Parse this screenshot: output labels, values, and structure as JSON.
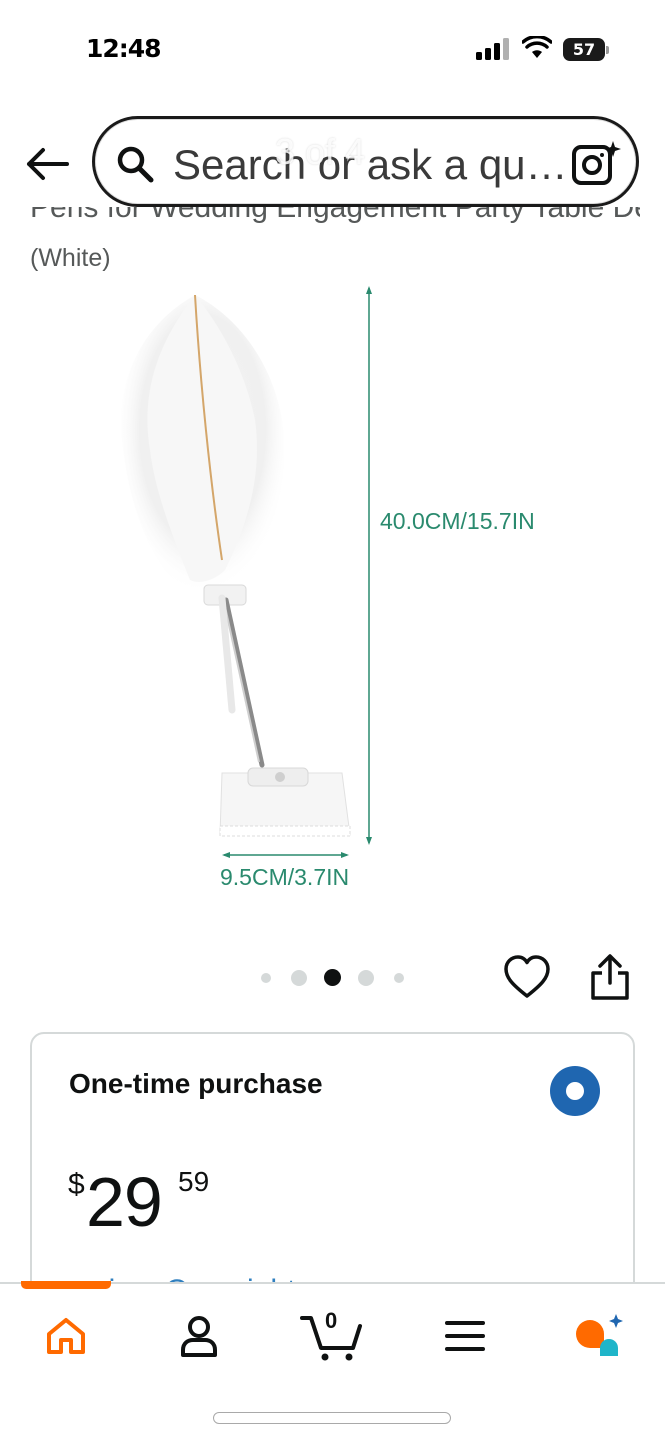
{
  "status_bar": {
    "time": "12:48",
    "battery": "57"
  },
  "header": {
    "search_placeholder": "Search or ask a qu…",
    "page_indicator": "3 of 4"
  },
  "product": {
    "title_line1": "Pens for Wedding Engagement Party Table Decor",
    "title_line2": "(White)",
    "image": {
      "height_label": "40.0CM/15.7IN",
      "width_label": "9.5CM/3.7IN"
    },
    "carousel": {
      "dot_count": 5,
      "active_index": 2
    }
  },
  "purchase": {
    "option_title": "One-time purchase",
    "price_symbol": "$",
    "price_whole": "29",
    "price_fraction": "59",
    "delivery_partial": "prime Overnight"
  },
  "bottom_nav": {
    "cart_count": "0",
    "active_tab": "home"
  },
  "colors": {
    "accent_orange": "#ff6a00",
    "radio_blue": "#1f66b0",
    "dimension_green": "#2a8a6e",
    "ai_icon_orange": "#ff6a00",
    "ai_icon_teal": "#1fb5c9"
  },
  "icons": {
    "back": "back-arrow-icon",
    "search": "search-icon",
    "camera": "camera-lens-icon",
    "heart": "heart-icon",
    "share": "share-icon",
    "home": "home-icon",
    "account": "person-icon",
    "cart": "cart-icon",
    "menu": "hamburger-menu-icon",
    "rufus": "ai-assistant-icon"
  }
}
